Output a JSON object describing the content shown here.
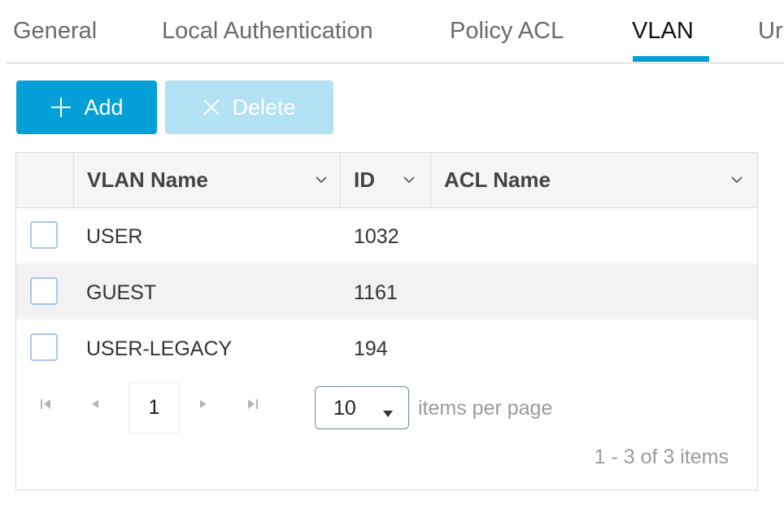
{
  "tabs": [
    {
      "label": "General"
    },
    {
      "label": "Local Authentication"
    },
    {
      "label": "Policy ACL"
    },
    {
      "label": "VLAN"
    },
    {
      "label": "Ur"
    }
  ],
  "active_tab": "VLAN",
  "toolbar": {
    "add_label": "Add",
    "delete_label": "Delete",
    "add_icon": "plus-icon",
    "delete_icon": "close-icon"
  },
  "table": {
    "columns": [
      "VLAN Name",
      "ID",
      "ACL Name"
    ],
    "rows": [
      {
        "vlan_name": "USER",
        "id": "1032",
        "acl_name": ""
      },
      {
        "vlan_name": "GUEST",
        "id": "1161",
        "acl_name": ""
      },
      {
        "vlan_name": "USER-LEGACY",
        "id": "194",
        "acl_name": ""
      }
    ]
  },
  "pagination": {
    "current_page": "1",
    "per_page": "10",
    "per_page_label": "items per page",
    "summary": "1 - 3 of 3 items"
  },
  "colors": {
    "accent": "#049fd9",
    "accent_disabled": "#b3e2f4",
    "checkbox_border": "#a9c6ec"
  }
}
